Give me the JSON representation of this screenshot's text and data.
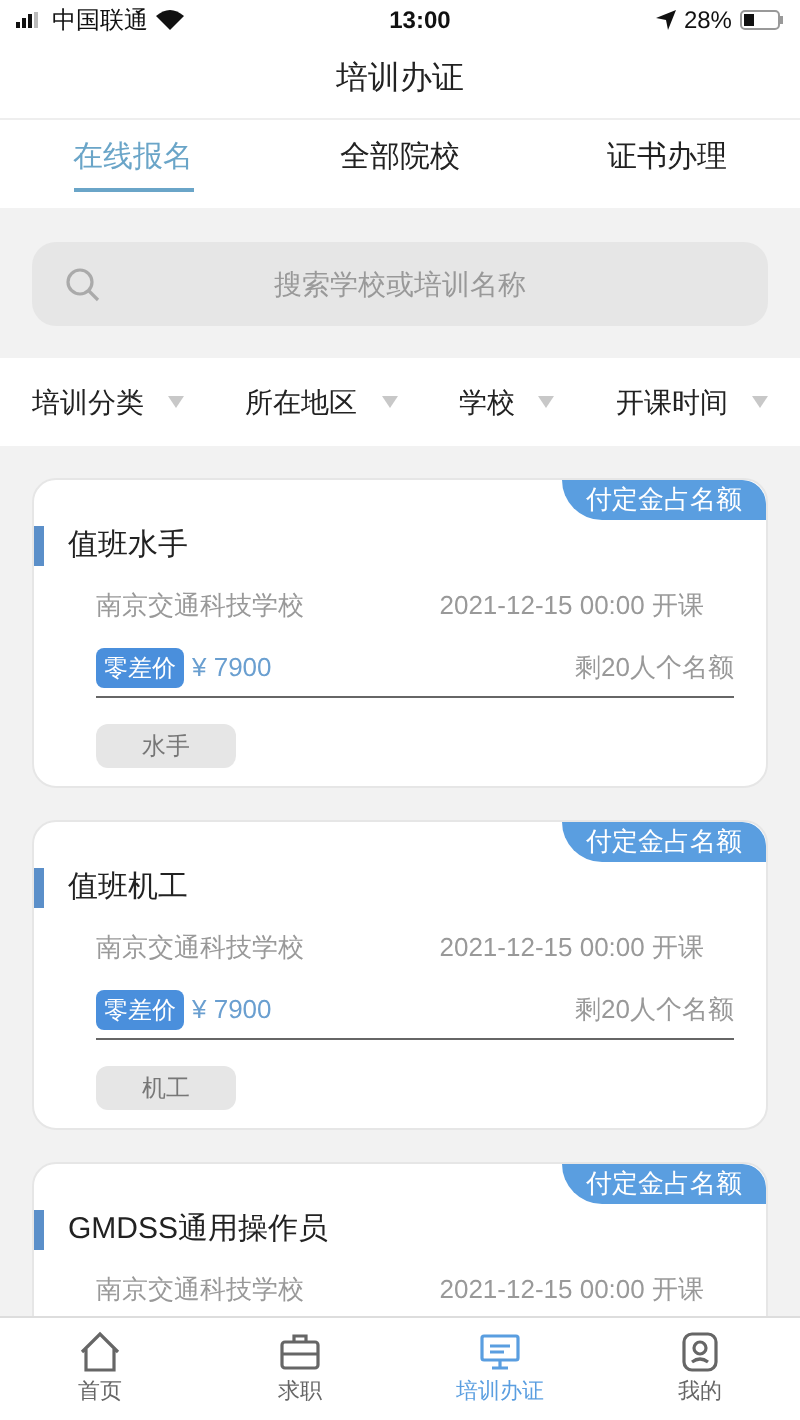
{
  "status_bar": {
    "carrier": "中国联通",
    "time": "13:00",
    "battery": "28%"
  },
  "title": "培训办证",
  "tabs": [
    {
      "label": "在线报名",
      "selected": true
    },
    {
      "label": "全部院校",
      "selected": false
    },
    {
      "label": "证书办理",
      "selected": false
    }
  ],
  "search": {
    "placeholder": "搜索学校或培训名称"
  },
  "filters": [
    "培训分类",
    "所在地区",
    "学校",
    "开课时间"
  ],
  "courses": [
    {
      "badge": "付定金占名额",
      "name": "值班水手",
      "school": "南京交通科技学校",
      "start": "2021-12-15 00:00 开课",
      "price_tag": "零差价",
      "price": "¥ 7900",
      "remaining": "剩20人个名额",
      "tag": "水手"
    },
    {
      "badge": "付定金占名额",
      "name": "值班机工",
      "school": "南京交通科技学校",
      "start": "2021-12-15 00:00 开课",
      "price_tag": "零差价",
      "price": "¥ 7900",
      "remaining": "剩20人个名额",
      "tag": "机工"
    },
    {
      "badge": "付定金占名额",
      "name": "GMDSS通用操作员",
      "school": "南京交通科技学校",
      "start": "2021-12-15 00:00 开课"
    }
  ],
  "tab_bar": [
    {
      "label": "首页",
      "kind": "home",
      "selected": false
    },
    {
      "label": "求职",
      "kind": "briefcase",
      "selected": false
    },
    {
      "label": "培训办证",
      "kind": "board",
      "selected": true
    },
    {
      "label": "我的",
      "kind": "user",
      "selected": false
    }
  ]
}
